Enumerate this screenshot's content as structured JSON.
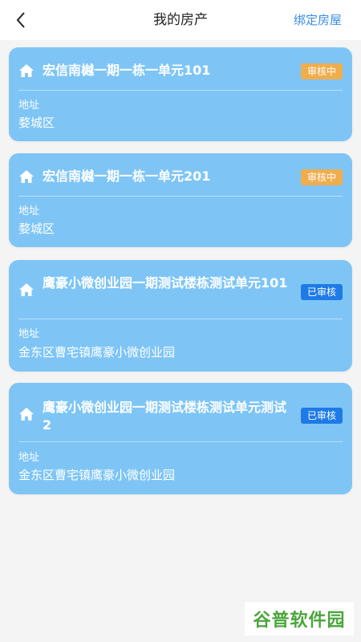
{
  "header": {
    "title": "我的房产",
    "action_label": "绑定房屋"
  },
  "properties": [
    {
      "title": "宏信南樾一期一栋一单元101",
      "status": "审核中",
      "status_type": "pending",
      "address_label": "地址",
      "address": "婺城区"
    },
    {
      "title": "宏信南樾一期一栋一单元201",
      "status": "审核中",
      "status_type": "pending",
      "address_label": "地址",
      "address": "婺城区"
    },
    {
      "title": "鹰豪小微创业园一期测试楼栋测试单元101",
      "status": "已审核",
      "status_type": "approved",
      "address_label": "地址",
      "address": "金东区曹宅镇鹰豪小微创业园"
    },
    {
      "title": "鹰豪小微创业园一期测试楼栋测试单元测试2",
      "status": "已审核",
      "status_type": "approved",
      "address_label": "地址",
      "address": "金东区曹宅镇鹰豪小微创业园"
    }
  ],
  "watermark": "谷普软件园",
  "colors": {
    "card": "#7ec5f6",
    "pending": "#f0ad4e",
    "approved": "#1e7be6",
    "link": "#3a8ee6"
  }
}
